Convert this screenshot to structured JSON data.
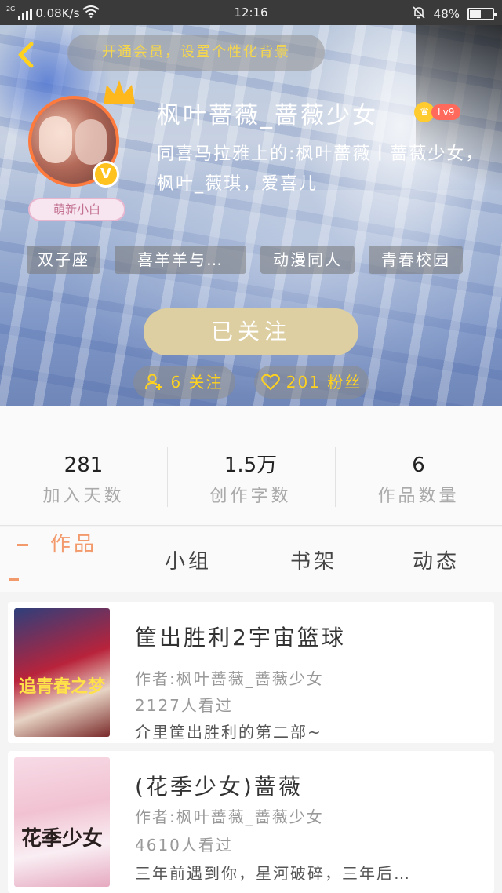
{
  "status_bar": {
    "network_tag": "2G",
    "speed": "0.08K/s",
    "time": "12:16",
    "battery": "48%",
    "battery_level": 0.48
  },
  "header": {
    "vip_banner": "开通会员，设置个性化背景",
    "cute_tag": "萌新小白",
    "nickname": "枫叶蔷薇_蔷薇少女",
    "level": "Lv9",
    "bio": "同喜马拉雅上的:枫叶蔷薇丨蔷薇少女，枫叶_薇琪，爱喜儿",
    "tags": [
      "双子座",
      "喜羊羊与…",
      "动漫同人",
      "青春校园"
    ],
    "follow_button": "已关注",
    "following": "6 关注",
    "fans": "201 粉丝"
  },
  "stats": [
    {
      "value": "281",
      "label": "加入天数"
    },
    {
      "value": "1.5万",
      "label": "创作字数"
    },
    {
      "value": "6",
      "label": "作品数量"
    }
  ],
  "tabs": [
    "作品",
    "小组",
    "书架",
    "动态"
  ],
  "works": [
    {
      "title": "筐出胜利2宇宙篮球",
      "author": "作者:枫叶蔷薇_蔷薇少女",
      "views": "2127人看过",
      "desc": "介里筐出胜利的第二部~",
      "cover_text": "追青春之梦"
    },
    {
      "title": "(花季少女)蔷薇",
      "author": "作者:枫叶蔷薇_蔷薇少女",
      "views": "4610人看过",
      "desc": "三年前遇到你，星河破碎，三年后…",
      "cover_text": "花季少女"
    }
  ],
  "colors": {
    "accent": "#f39a6c",
    "follow_button": "#ddcfa1",
    "gold": "#ffd21f"
  }
}
